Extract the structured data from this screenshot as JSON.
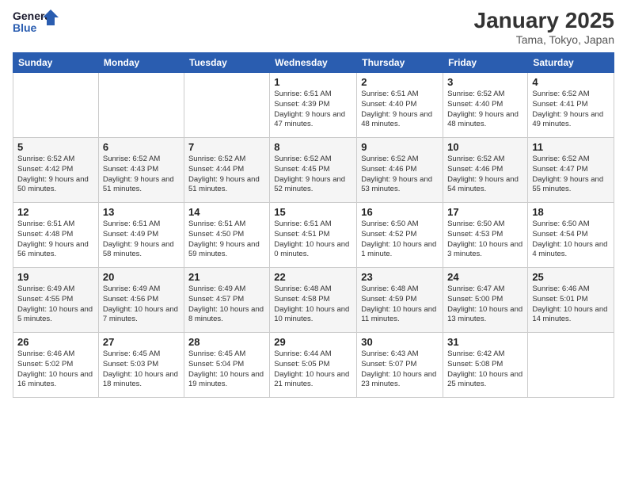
{
  "header": {
    "logo_line1": "General",
    "logo_line2": "Blue",
    "month": "January 2025",
    "location": "Tama, Tokyo, Japan"
  },
  "weekdays": [
    "Sunday",
    "Monday",
    "Tuesday",
    "Wednesday",
    "Thursday",
    "Friday",
    "Saturday"
  ],
  "weeks": [
    [
      {
        "day": "",
        "info": ""
      },
      {
        "day": "",
        "info": ""
      },
      {
        "day": "",
        "info": ""
      },
      {
        "day": "1",
        "info": "Sunrise: 6:51 AM\nSunset: 4:39 PM\nDaylight: 9 hours and 47 minutes."
      },
      {
        "day": "2",
        "info": "Sunrise: 6:51 AM\nSunset: 4:40 PM\nDaylight: 9 hours and 48 minutes."
      },
      {
        "day": "3",
        "info": "Sunrise: 6:52 AM\nSunset: 4:40 PM\nDaylight: 9 hours and 48 minutes."
      },
      {
        "day": "4",
        "info": "Sunrise: 6:52 AM\nSunset: 4:41 PM\nDaylight: 9 hours and 49 minutes."
      }
    ],
    [
      {
        "day": "5",
        "info": "Sunrise: 6:52 AM\nSunset: 4:42 PM\nDaylight: 9 hours and 50 minutes."
      },
      {
        "day": "6",
        "info": "Sunrise: 6:52 AM\nSunset: 4:43 PM\nDaylight: 9 hours and 51 minutes."
      },
      {
        "day": "7",
        "info": "Sunrise: 6:52 AM\nSunset: 4:44 PM\nDaylight: 9 hours and 51 minutes."
      },
      {
        "day": "8",
        "info": "Sunrise: 6:52 AM\nSunset: 4:45 PM\nDaylight: 9 hours and 52 minutes."
      },
      {
        "day": "9",
        "info": "Sunrise: 6:52 AM\nSunset: 4:46 PM\nDaylight: 9 hours and 53 minutes."
      },
      {
        "day": "10",
        "info": "Sunrise: 6:52 AM\nSunset: 4:46 PM\nDaylight: 9 hours and 54 minutes."
      },
      {
        "day": "11",
        "info": "Sunrise: 6:52 AM\nSunset: 4:47 PM\nDaylight: 9 hours and 55 minutes."
      }
    ],
    [
      {
        "day": "12",
        "info": "Sunrise: 6:51 AM\nSunset: 4:48 PM\nDaylight: 9 hours and 56 minutes."
      },
      {
        "day": "13",
        "info": "Sunrise: 6:51 AM\nSunset: 4:49 PM\nDaylight: 9 hours and 58 minutes."
      },
      {
        "day": "14",
        "info": "Sunrise: 6:51 AM\nSunset: 4:50 PM\nDaylight: 9 hours and 59 minutes."
      },
      {
        "day": "15",
        "info": "Sunrise: 6:51 AM\nSunset: 4:51 PM\nDaylight: 10 hours and 0 minutes."
      },
      {
        "day": "16",
        "info": "Sunrise: 6:50 AM\nSunset: 4:52 PM\nDaylight: 10 hours and 1 minute."
      },
      {
        "day": "17",
        "info": "Sunrise: 6:50 AM\nSunset: 4:53 PM\nDaylight: 10 hours and 3 minutes."
      },
      {
        "day": "18",
        "info": "Sunrise: 6:50 AM\nSunset: 4:54 PM\nDaylight: 10 hours and 4 minutes."
      }
    ],
    [
      {
        "day": "19",
        "info": "Sunrise: 6:49 AM\nSunset: 4:55 PM\nDaylight: 10 hours and 5 minutes."
      },
      {
        "day": "20",
        "info": "Sunrise: 6:49 AM\nSunset: 4:56 PM\nDaylight: 10 hours and 7 minutes."
      },
      {
        "day": "21",
        "info": "Sunrise: 6:49 AM\nSunset: 4:57 PM\nDaylight: 10 hours and 8 minutes."
      },
      {
        "day": "22",
        "info": "Sunrise: 6:48 AM\nSunset: 4:58 PM\nDaylight: 10 hours and 10 minutes."
      },
      {
        "day": "23",
        "info": "Sunrise: 6:48 AM\nSunset: 4:59 PM\nDaylight: 10 hours and 11 minutes."
      },
      {
        "day": "24",
        "info": "Sunrise: 6:47 AM\nSunset: 5:00 PM\nDaylight: 10 hours and 13 minutes."
      },
      {
        "day": "25",
        "info": "Sunrise: 6:46 AM\nSunset: 5:01 PM\nDaylight: 10 hours and 14 minutes."
      }
    ],
    [
      {
        "day": "26",
        "info": "Sunrise: 6:46 AM\nSunset: 5:02 PM\nDaylight: 10 hours and 16 minutes."
      },
      {
        "day": "27",
        "info": "Sunrise: 6:45 AM\nSunset: 5:03 PM\nDaylight: 10 hours and 18 minutes."
      },
      {
        "day": "28",
        "info": "Sunrise: 6:45 AM\nSunset: 5:04 PM\nDaylight: 10 hours and 19 minutes."
      },
      {
        "day": "29",
        "info": "Sunrise: 6:44 AM\nSunset: 5:05 PM\nDaylight: 10 hours and 21 minutes."
      },
      {
        "day": "30",
        "info": "Sunrise: 6:43 AM\nSunset: 5:07 PM\nDaylight: 10 hours and 23 minutes."
      },
      {
        "day": "31",
        "info": "Sunrise: 6:42 AM\nSunset: 5:08 PM\nDaylight: 10 hours and 25 minutes."
      },
      {
        "day": "",
        "info": ""
      }
    ]
  ]
}
